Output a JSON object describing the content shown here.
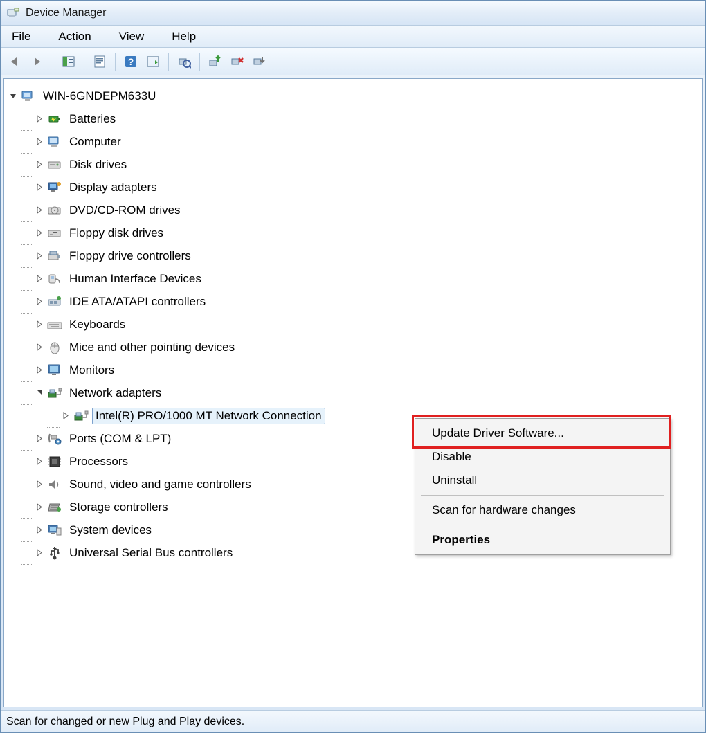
{
  "window": {
    "title": "Device Manager"
  },
  "menu": {
    "items": [
      "File",
      "Action",
      "View",
      "Help"
    ]
  },
  "toolbar": {
    "buttons": [
      {
        "name": "back-icon"
      },
      {
        "name": "forward-icon"
      },
      {
        "sep": true
      },
      {
        "name": "show-hide-console-tree-icon"
      },
      {
        "sep": true
      },
      {
        "name": "properties-icon"
      },
      {
        "sep": true
      },
      {
        "name": "help-icon"
      },
      {
        "name": "action-icon"
      },
      {
        "sep": true
      },
      {
        "name": "scan-hardware-icon"
      },
      {
        "sep": true
      },
      {
        "name": "update-driver-icon"
      },
      {
        "name": "uninstall-icon"
      },
      {
        "name": "disable-icon"
      }
    ]
  },
  "tree": {
    "root": {
      "label": "WIN-6GNDEPM633U",
      "expanded": true,
      "icon": "computer-icon",
      "children": [
        {
          "label": "Batteries",
          "icon": "battery-icon"
        },
        {
          "label": "Computer",
          "icon": "computer-icon"
        },
        {
          "label": "Disk drives",
          "icon": "disk-drive-icon"
        },
        {
          "label": "Display adapters",
          "icon": "display-adapter-icon"
        },
        {
          "label": "DVD/CD-ROM drives",
          "icon": "dvd-drive-icon"
        },
        {
          "label": "Floppy disk drives",
          "icon": "floppy-drive-icon"
        },
        {
          "label": "Floppy drive controllers",
          "icon": "floppy-controller-icon"
        },
        {
          "label": "Human Interface Devices",
          "icon": "hid-icon"
        },
        {
          "label": "IDE ATA/ATAPI controllers",
          "icon": "ide-controller-icon"
        },
        {
          "label": "Keyboards",
          "icon": "keyboard-icon"
        },
        {
          "label": "Mice and other pointing devices",
          "icon": "mouse-icon"
        },
        {
          "label": "Monitors",
          "icon": "monitor-icon"
        },
        {
          "label": "Network adapters",
          "icon": "network-adapter-icon",
          "expanded": true,
          "children": [
            {
              "label": "Intel(R) PRO/1000 MT Network Connection",
              "icon": "network-adapter-icon",
              "selected": true
            }
          ]
        },
        {
          "label": "Ports (COM & LPT)",
          "icon": "ports-icon"
        },
        {
          "label": "Processors",
          "icon": "processor-icon"
        },
        {
          "label": "Sound, video and game controllers",
          "icon": "sound-icon"
        },
        {
          "label": "Storage controllers",
          "icon": "storage-controller-icon"
        },
        {
          "label": "System devices",
          "icon": "system-device-icon"
        },
        {
          "label": "Universal Serial Bus controllers",
          "icon": "usb-icon"
        }
      ]
    }
  },
  "context_menu": {
    "items": [
      {
        "label": "Update Driver Software...",
        "highlight": true
      },
      {
        "label": "Disable"
      },
      {
        "label": "Uninstall"
      },
      {
        "sep": true
      },
      {
        "label": "Scan for hardware changes"
      },
      {
        "sep": true
      },
      {
        "label": "Properties",
        "bold": true
      }
    ]
  },
  "statusbar": {
    "text": "Scan for changed or new Plug and Play devices."
  }
}
